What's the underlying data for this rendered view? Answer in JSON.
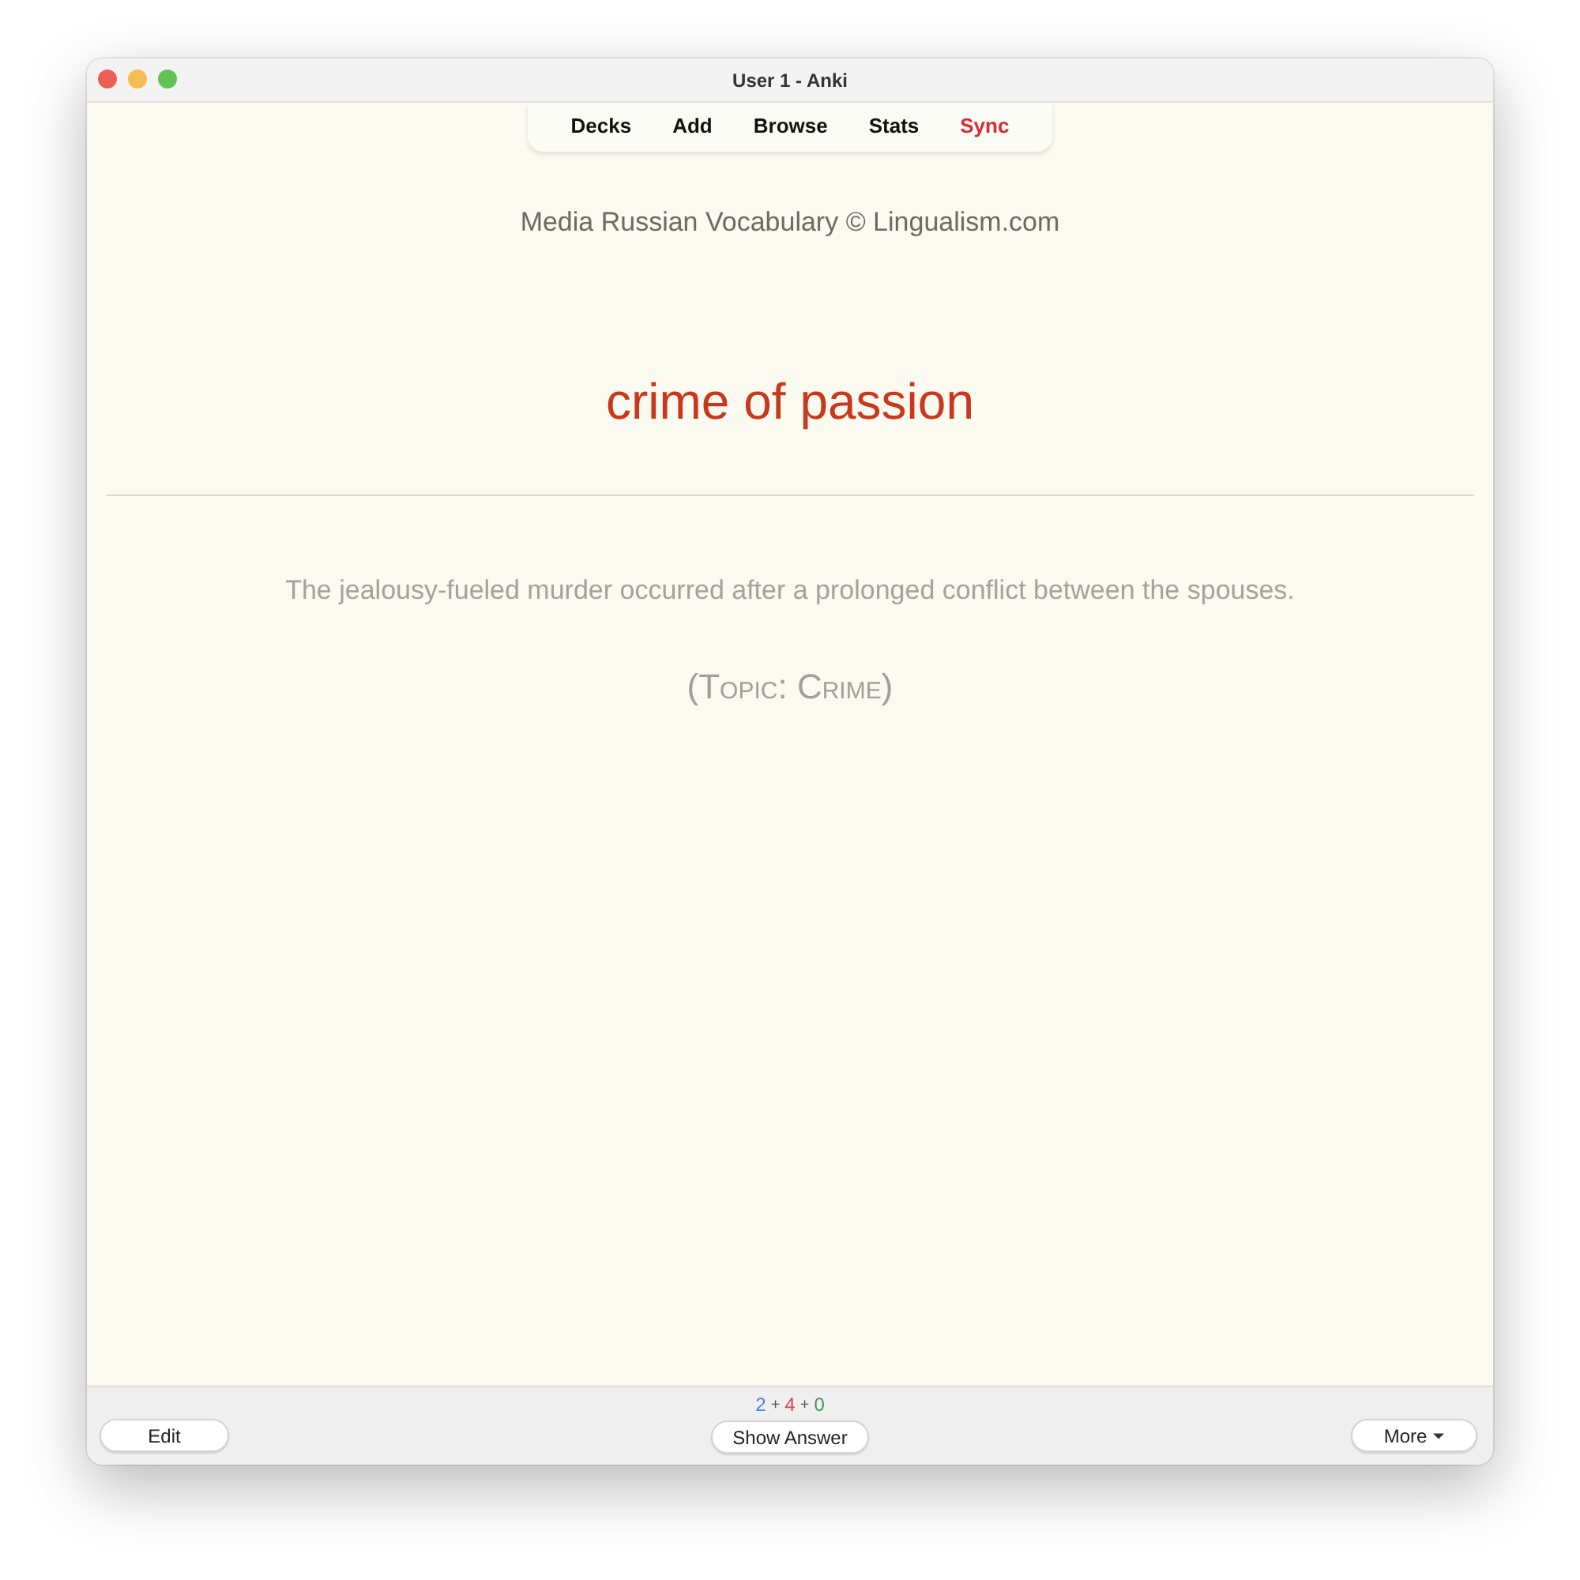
{
  "window": {
    "title": "User 1 - Anki"
  },
  "toolbar": {
    "items": [
      {
        "label": "Decks",
        "highlighted": false
      },
      {
        "label": "Add",
        "highlighted": false
      },
      {
        "label": "Browse",
        "highlighted": false
      },
      {
        "label": "Stats",
        "highlighted": false
      },
      {
        "label": "Sync",
        "highlighted": true
      }
    ]
  },
  "card": {
    "deck_name": "Media Russian Vocabulary © Lingualism.com",
    "front": "crime of passion",
    "sentence": "The jealousy-fueled murder occurred after a prolonged conflict between the spouses.",
    "topic": "(Topic: Crime)"
  },
  "bottom_bar": {
    "edit_button": {
      "label": "Edit"
    },
    "counts": [
      {
        "kind": "count",
        "text": "2",
        "color": "#4a7de0"
      },
      {
        "kind": "separator",
        "text": "+",
        "color": "#555555"
      },
      {
        "kind": "count",
        "text": "4",
        "color": "#d9434a"
      },
      {
        "kind": "separator",
        "text": "+",
        "color": "#555555"
      },
      {
        "kind": "count",
        "text": "0",
        "color": "#3a9a5a"
      }
    ],
    "answer_button": {
      "label": "Show Answer"
    },
    "more_button": {
      "label": "More",
      "dropdown": true
    }
  }
}
